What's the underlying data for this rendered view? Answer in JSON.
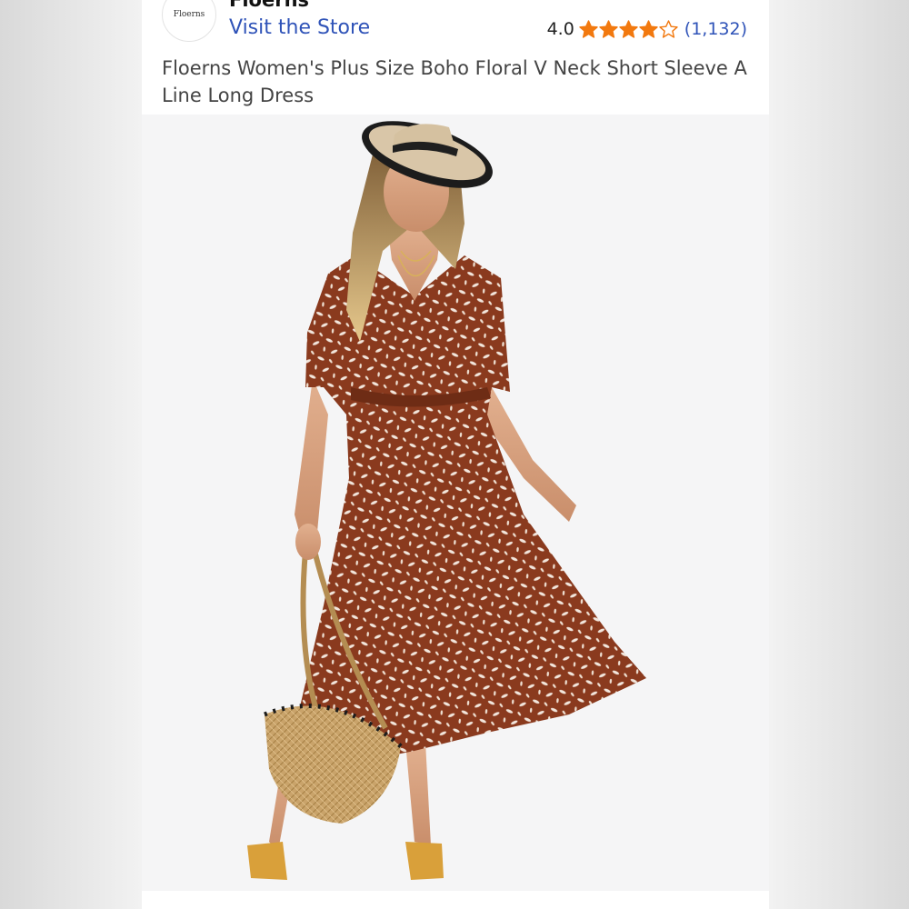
{
  "store": {
    "logo_text": "Floerns",
    "brand_name": "Floerns",
    "visit_store_label": "Visit the Store"
  },
  "rating": {
    "value": "4.0",
    "stars_filled": 4,
    "stars_total": 5,
    "review_count": "(1,132)",
    "star_color": "#f2790f"
  },
  "product": {
    "title": "Floerns Women's Plus Size Boho Floral V Neck Short Sleeve A Line Long Dress",
    "image_alt": "model wearing rust brown floral maxi dress with straw hat and woven basket bag"
  },
  "colors": {
    "link": "#2f53b8",
    "dress": "#8a3a1e",
    "background": "#f5f5f6"
  }
}
